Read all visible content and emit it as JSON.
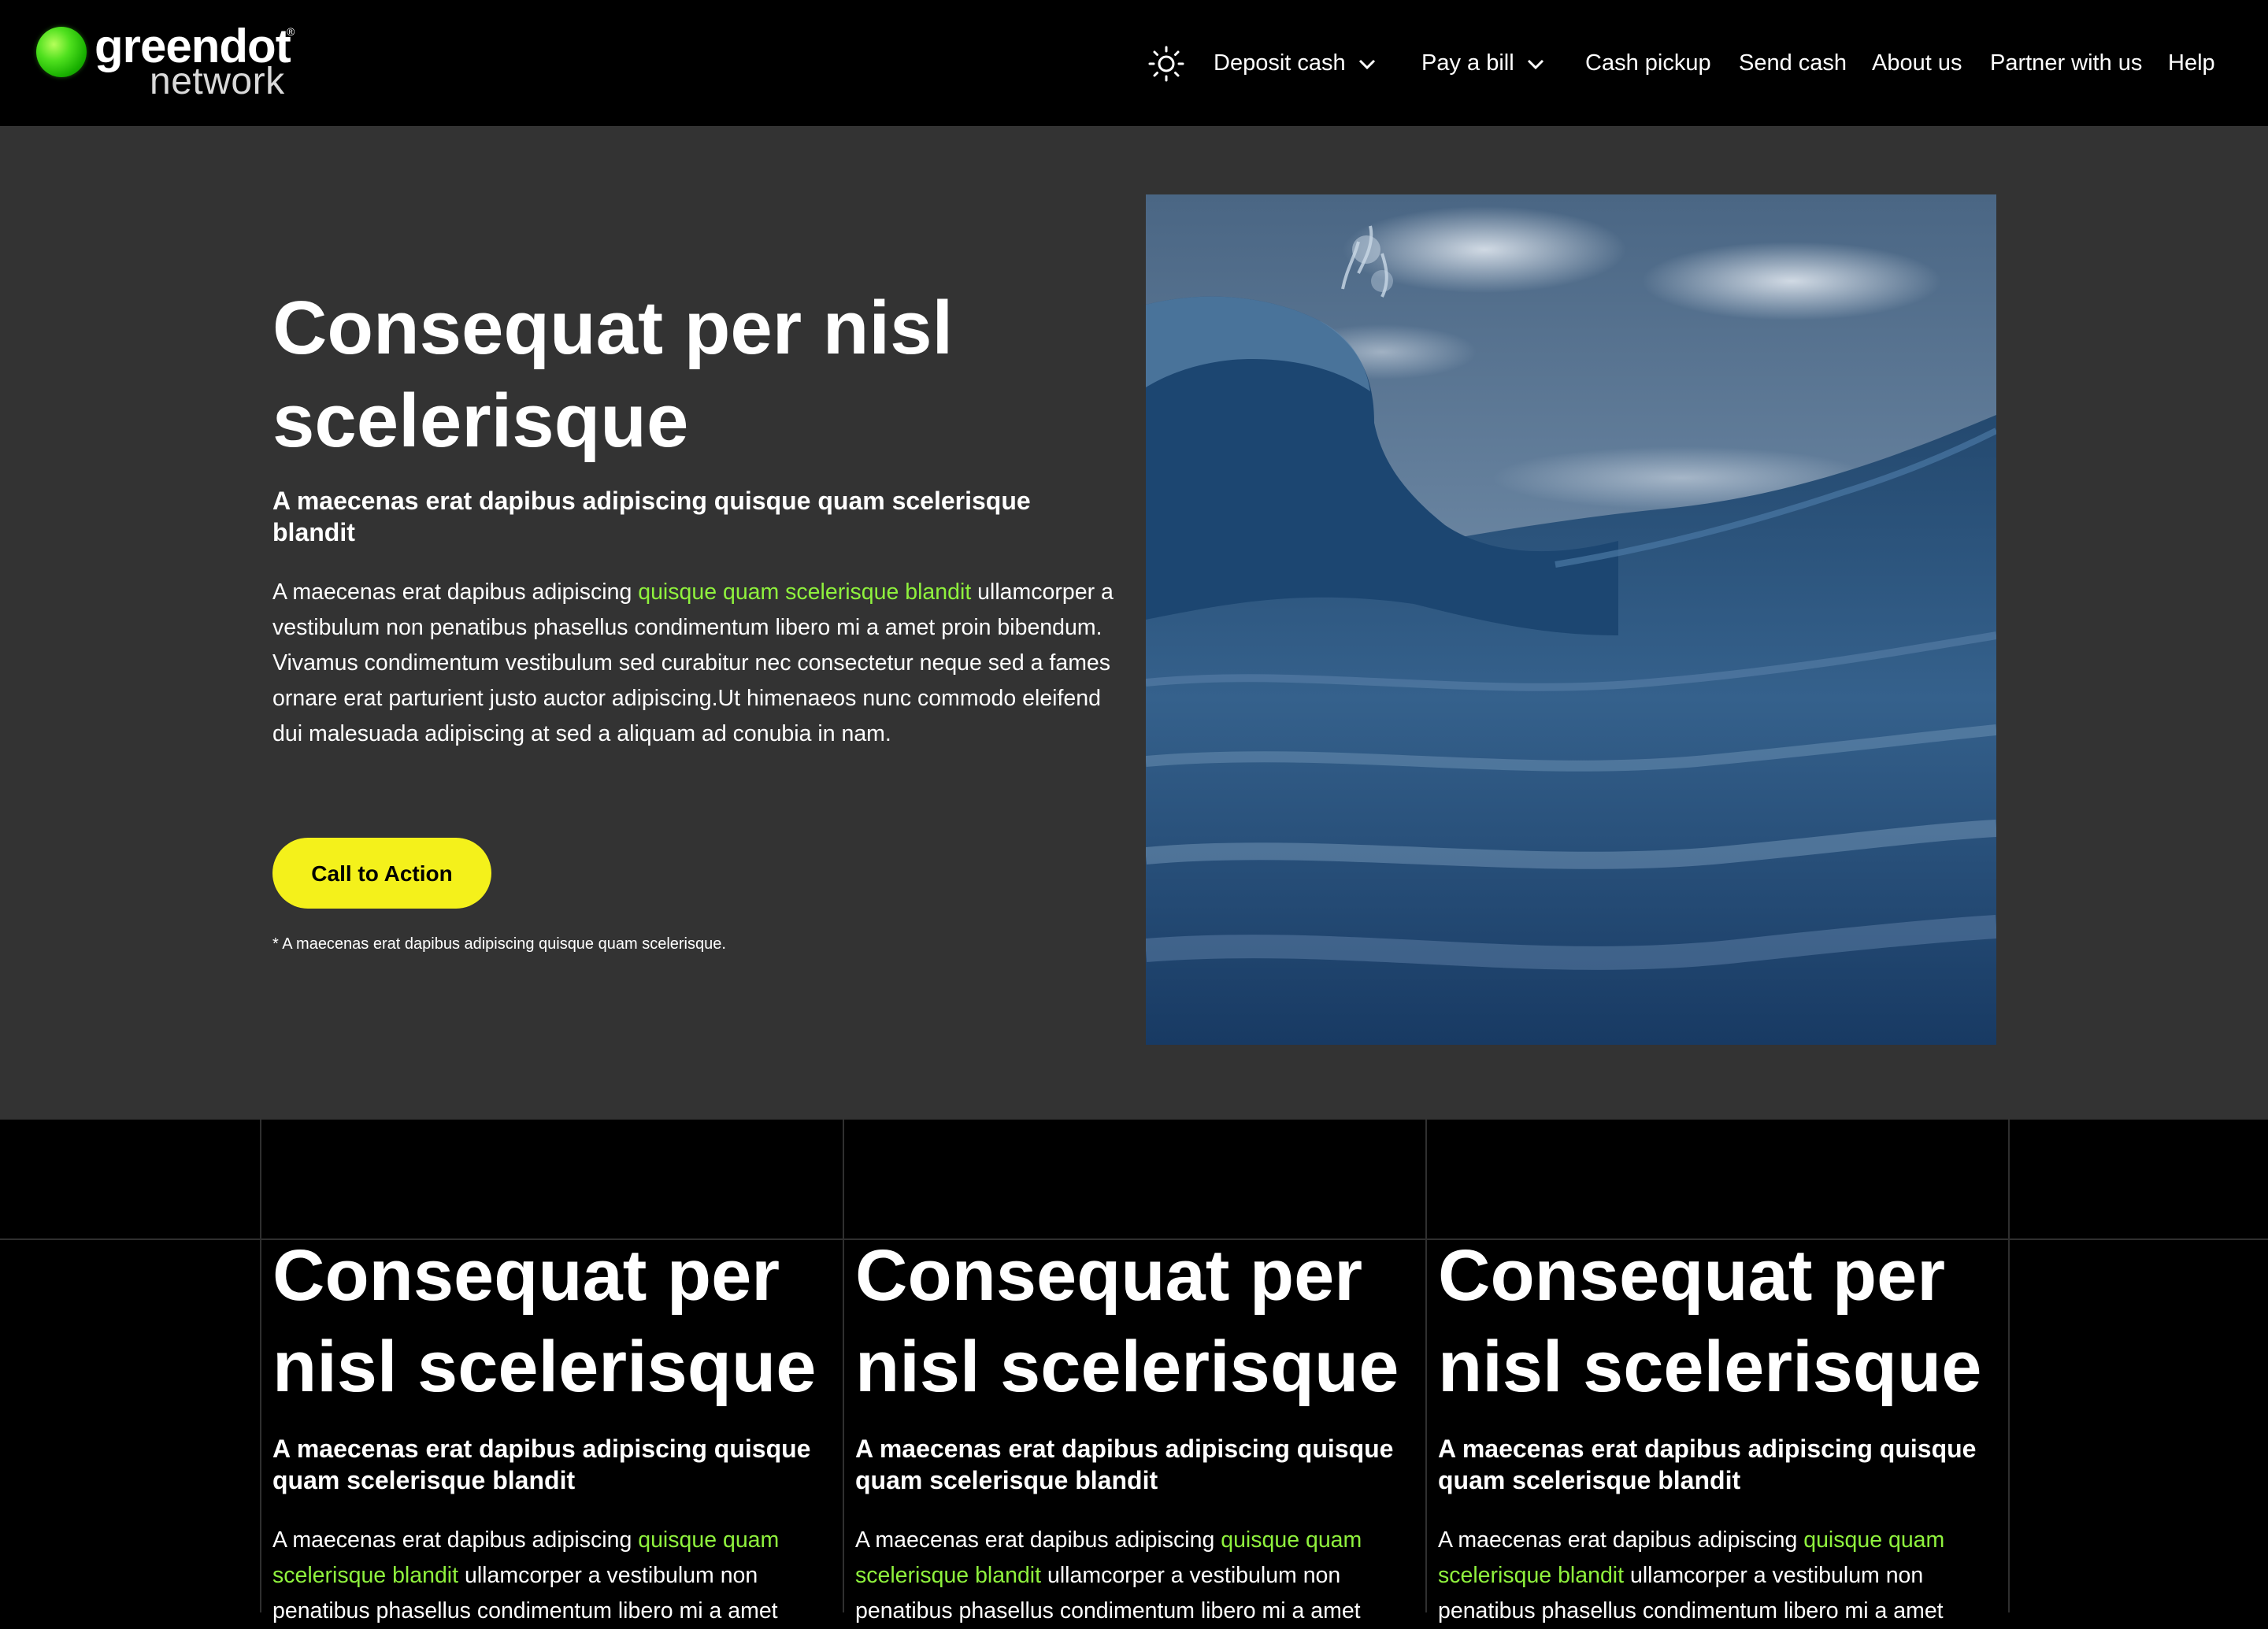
{
  "brand": {
    "name_top": "greendot",
    "registered": "®",
    "name_bottom": "network",
    "accent_green": "#4fe01e",
    "highlight_green": "#8ff23d",
    "cta_yellow": "#f4f11b"
  },
  "nav": {
    "theme_icon": "sun-icon",
    "items": [
      {
        "label": "Deposit cash",
        "dropdown": true
      },
      {
        "label": "Pay a bill",
        "dropdown": true
      },
      {
        "label": "Cash pickup",
        "dropdown": false
      },
      {
        "label": "Send cash",
        "dropdown": false
      },
      {
        "label": "About us",
        "dropdown": false
      },
      {
        "label": "Partner with us",
        "dropdown": false
      },
      {
        "label": "Help",
        "dropdown": false
      }
    ]
  },
  "hero": {
    "title": "Consequat per nisl scelerisque",
    "subtitle": "A maecenas erat dapibus adipiscing quisque quam scelerisque blandit",
    "body_before": "A maecenas erat dapibus adipiscing ",
    "body_link": "quisque quam scelerisque blandit",
    "body_after": " ullamcorper a vestibulum non penatibus phasellus condimentum libero mi a amet proin bibendum. Vivamus condimentum vestibulum sed curabitur nec consectetur neque sed a fames ornare erat parturient justo auctor adipiscing.Ut himenaeos nunc commodo eleifend dui malesuada adipiscing at sed a aliquam ad conubia in nam.",
    "cta_label": "Call to Action",
    "footnote": "* A maecenas erat dapibus adipiscing quisque quam scelerisque."
  },
  "columns": [
    {
      "title": "Consequat per nisl scelerisque",
      "subtitle": "A maecenas erat dapibus adipiscing quisque quam scelerisque blandit",
      "body_before": "A maecenas erat dapibus adipiscing ",
      "body_link": "quisque quam scelerisque blandit",
      "body_after": " ullamcorper a vestibulum non penatibus phasellus condimentum libero mi a amet"
    },
    {
      "title": "Consequat per nisl scelerisque",
      "subtitle": "A maecenas erat dapibus adipiscing quisque quam scelerisque blandit",
      "body_before": "A maecenas erat dapibus adipiscing ",
      "body_link": "quisque quam scelerisque blandit",
      "body_after": " ullamcorper a vestibulum non penatibus phasellus condimentum libero mi a amet"
    },
    {
      "title": "Consequat per nisl scelerisque",
      "subtitle": "A maecenas erat dapibus adipiscing quisque quam scelerisque blandit",
      "body_before": "A maecenas erat dapibus adipiscing ",
      "body_link": "quisque quam scelerisque blandit",
      "body_after": " ullamcorper a vestibulum non penatibus phasellus condimentum libero mi a amet"
    }
  ]
}
